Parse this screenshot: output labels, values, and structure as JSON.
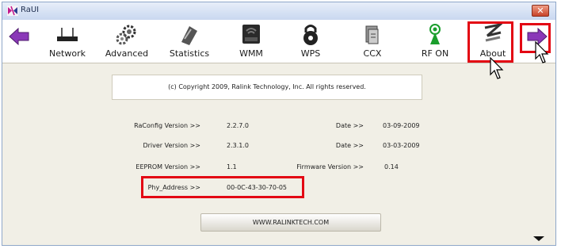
{
  "window": {
    "title": "RaUI",
    "close_label": "✕"
  },
  "toolbar": {
    "network": "Network",
    "advanced": "Advanced",
    "statistics": "Statistics",
    "wmm": "WMM",
    "wps": "WPS",
    "ccx": "CCX",
    "rf": "RF ON",
    "about": "About"
  },
  "about": {
    "copyright": "(c) Copyright 2009, Ralink Technology, Inc.  All rights reserved.",
    "raconfig_label": "RaConfig Version >>",
    "raconfig_value": "2.2.7.0",
    "raconfig_date_label": "Date >>",
    "raconfig_date": "03-09-2009",
    "driver_label": "Driver Version >>",
    "driver_value": "2.3.1.0",
    "driver_date_label": "Date >>",
    "driver_date": "03-03-2009",
    "eeprom_label": "EEPROM Version >>",
    "eeprom_value": "1.1",
    "firmware_label": "Firmware Version >>",
    "firmware_value": "0.14",
    "phy_label": "Phy_Address >>",
    "phy_value": "00-0C-43-30-70-05",
    "website": "WWW.RALINKTECH.COM"
  },
  "colors": {
    "highlight": "#e30613",
    "arrow_purple": "#7a2ea8"
  }
}
